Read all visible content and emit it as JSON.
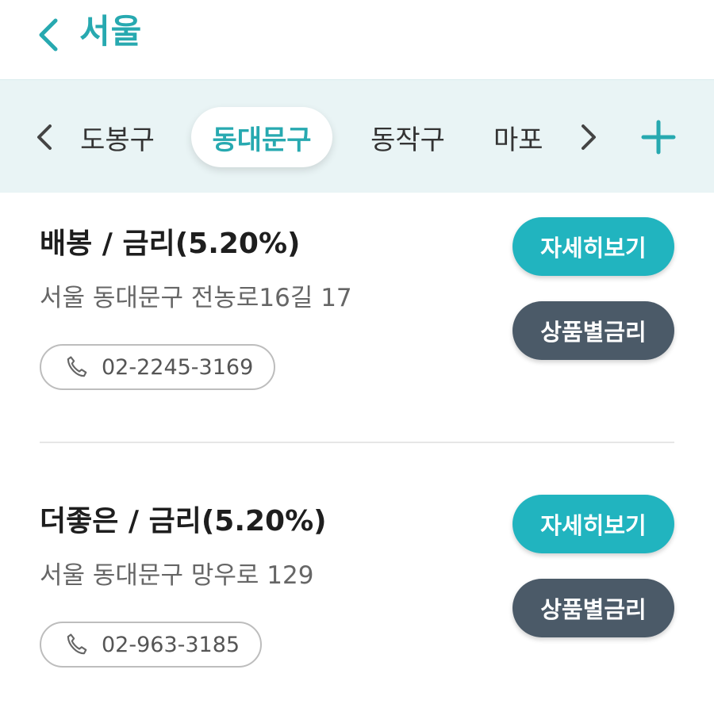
{
  "header": {
    "title": "서울",
    "back_icon": "chevron-left-icon"
  },
  "tabs": {
    "items": [
      {
        "label": "도봉구",
        "selected": false
      },
      {
        "label": "동대문구",
        "selected": true
      },
      {
        "label": "동작구",
        "selected": false
      },
      {
        "label": "마포",
        "selected": false
      }
    ],
    "prev_icon": "chevron-left-icon",
    "next_icon": "chevron-right-icon",
    "add_icon": "plus-icon"
  },
  "stores": [
    {
      "title": "배봉 / 금리(5.20%)",
      "address": "서울 동대문구 전농로16길 17",
      "phone": "02-2245-3169",
      "detail_label": "자세히보기",
      "rate_label": "상품별금리"
    },
    {
      "title": "더좋은 / 금리(5.20%)",
      "address": "서울 동대문구 망우로 129",
      "phone": "02-963-3185",
      "detail_label": "자세히보기",
      "rate_label": "상품별금리"
    }
  ],
  "colors": {
    "accent": "#27a9b0",
    "detail_button": "#21b4bf",
    "rate_button": "#4b5a68",
    "tabs_background": "#e9f4f5"
  }
}
